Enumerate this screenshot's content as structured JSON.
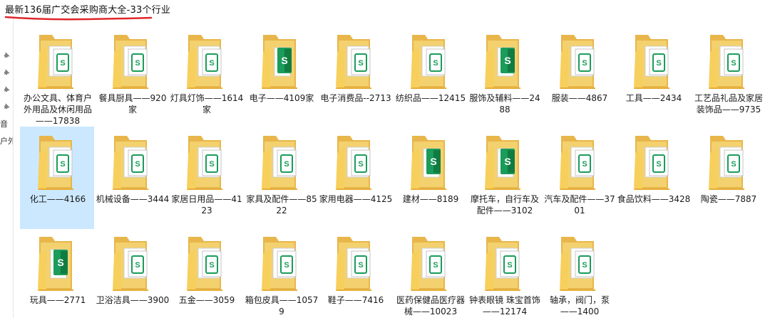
{
  "window": {
    "title": "最新136届广交会采购商大全-33个行业",
    "accent_color": "#e0262a"
  },
  "sidebar": {
    "partial_labels": [
      "音",
      "户外"
    ]
  },
  "folders": [
    {
      "label": "办公文具、体育户外用品及休闲用品——17838",
      "icon": "document-icon",
      "selected": false
    },
    {
      "label": "餐具厨具——920家",
      "icon": "document-icon",
      "selected": false
    },
    {
      "label": "灯具灯饰——1614家",
      "icon": "document-icon",
      "selected": false
    },
    {
      "label": "电子——4109家",
      "icon": "spreadsheet-icon",
      "selected": false
    },
    {
      "label": "电子消费品--2713",
      "icon": "document-icon",
      "selected": false
    },
    {
      "label": "纺织品——12415",
      "icon": "document-icon",
      "selected": false
    },
    {
      "label": "服饰及辅料——2488",
      "icon": "spreadsheet-icon",
      "selected": false
    },
    {
      "label": "服装——4867",
      "icon": "document-icon",
      "selected": false
    },
    {
      "label": "工具——2434",
      "icon": "document-icon",
      "selected": false
    },
    {
      "label": "工艺品礼品及家居装饰品——9735",
      "icon": "document-icon",
      "selected": false
    },
    {
      "label": "化工——4166",
      "icon": "document-icon",
      "selected": true
    },
    {
      "label": "机械设备——3444",
      "icon": "document-icon",
      "selected": false
    },
    {
      "label": "家居日用品——4123",
      "icon": "document-icon",
      "selected": false
    },
    {
      "label": "家具及配件——8522",
      "icon": "document-icon",
      "selected": false
    },
    {
      "label": "家用电器——4125",
      "icon": "document-icon",
      "selected": false
    },
    {
      "label": "建材——8189",
      "icon": "spreadsheet-icon",
      "selected": false
    },
    {
      "label": "摩托车，自行车及配件——3102",
      "icon": "spreadsheet-icon",
      "selected": false
    },
    {
      "label": "汽车及配件——3701",
      "icon": "document-icon",
      "selected": false
    },
    {
      "label": "食品饮料——3428",
      "icon": "document-icon",
      "selected": false
    },
    {
      "label": "陶瓷——7887",
      "icon": "document-icon",
      "selected": false
    },
    {
      "label": "玩具——2771",
      "icon": "spreadsheet-icon",
      "selected": false
    },
    {
      "label": "卫浴洁具——3900",
      "icon": "document-icon",
      "selected": false
    },
    {
      "label": "五金——3059",
      "icon": "document-icon",
      "selected": false
    },
    {
      "label": "箱包皮具——10579",
      "icon": "document-icon",
      "selected": false
    },
    {
      "label": "鞋子——7416",
      "icon": "document-icon",
      "selected": false
    },
    {
      "label": "医药保健品医疗器械——10023",
      "icon": "document-icon",
      "selected": false
    },
    {
      "label": "钟表眼镜 珠宝首饰——12174",
      "icon": "document-icon",
      "selected": false
    },
    {
      "label": "轴承，阀门，泵——1400",
      "icon": "document-icon",
      "selected": false
    }
  ]
}
